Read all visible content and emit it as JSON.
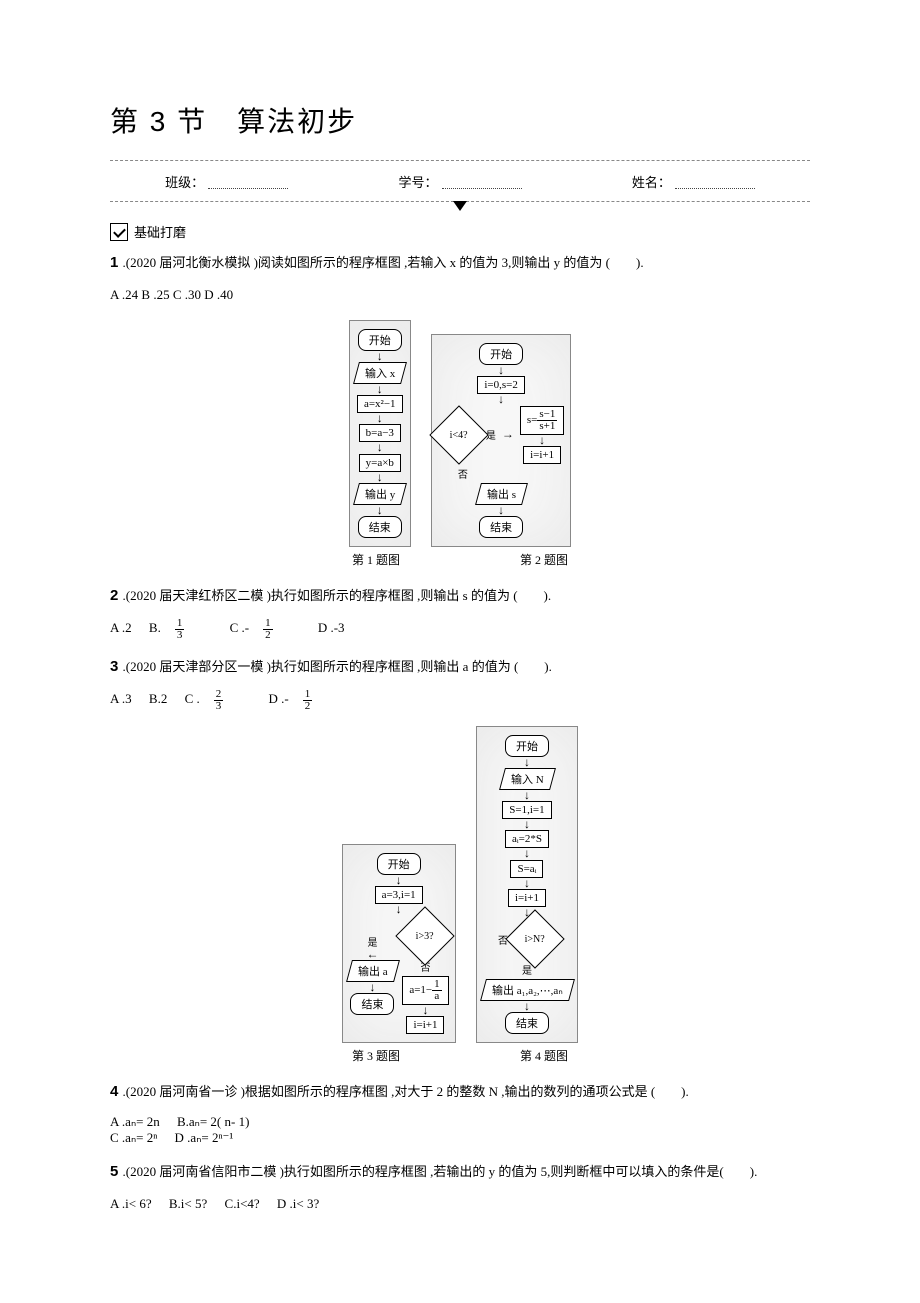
{
  "title": "第 3 节　算法初步",
  "header": {
    "class": "班级：",
    "id": "学号：",
    "name": "姓名："
  },
  "section1": "基础打磨",
  "q1": {
    "text": ".(2020 届河北衡水模拟 )阅读如图所示的程序框图 ,若输入 x 的值为 3,则输出 y 的值为 (　　).",
    "options": "A .24 B .25 C .30 D .40"
  },
  "caption12": {
    "c1": "第 1 题图",
    "c2": "第 2 题图"
  },
  "q2": {
    "text": ".(2020 届天津红桥区二模 )执行如图所示的程序框图 ,则输出 s 的值为 (　　).",
    "oA": "A .2",
    "oB_pre": "B.",
    "oB_n": "1",
    "oB_d": "3",
    "oC_pre": "C .-",
    "oC_n": "1",
    "oC_d": "2",
    "oD": "D .-3"
  },
  "q3": {
    "text": ".(2020 届天津部分区一模 )执行如图所示的程序框图 ,则输出 a 的值为 (　　).",
    "oA": "A .3",
    "oB": "B.2",
    "oC_pre": "C .",
    "oC_n": "2",
    "oC_d": "3",
    "oD_pre": "D .-",
    "oD_n": "1",
    "oD_d": "2"
  },
  "caption34": {
    "c3": "第 3 题图",
    "c4": "第 4 题图"
  },
  "q4": {
    "text": ".(2020 届河南省一诊 )根据如图所示的程序框图 ,对大于 2 的整数 N ,输出的数列的通项公式是 (　　).",
    "oA": "A .aₙ= 2n",
    "oB": "B.aₙ= 2( n- 1)",
    "oC": "C .aₙ= 2ⁿ",
    "oD": "D .aₙ= 2ⁿ⁻¹"
  },
  "q5": {
    "text": ".(2020 届河南省信阳市二模 )执行如图所示的程序框图 ,若输出的 y 的值为 5,则判断框中可以填入的条件是(　　).",
    "oA": "A .i< 6?",
    "oB": "B.i< 5?",
    "oC": "C.i<4?",
    "oD": "D .i< 3?"
  },
  "flow1": {
    "start": "开始",
    "in": "输入 x",
    "s1": "a=x²−1",
    "s2": "b=a−3",
    "s3": "y=a×b",
    "out": "输出 y",
    "end": "结束"
  },
  "flow2": {
    "start": "开始",
    "init": "i=0,s=2",
    "cond": "i<4?",
    "yes": "是",
    "no": "否",
    "upd_s": "s=",
    "upd_s_n": "s−1",
    "upd_s_d": "s+1",
    "upd_i": "i=i+1",
    "out": "输出 s",
    "end": "结束"
  },
  "flow3": {
    "start": "开始",
    "init": "a=3,i=1",
    "cond": "i>3?",
    "yes": "是",
    "no": "否",
    "out": "输出 a",
    "upd_a_pre": "a=1−",
    "upd_a_n": "1",
    "upd_a_d": "a",
    "upd_i": "i=i+1",
    "end": "结束"
  },
  "flow4": {
    "start": "开始",
    "in": "输入 N",
    "init": "S=1,i=1",
    "s1": "aᵢ=2*S",
    "s2": "S=aᵢ",
    "s3": "i=i+1",
    "cond": "i>N?",
    "yes": "是",
    "no": "否",
    "out": "输出 a₁,a₂,⋯,aₙ",
    "end": "结束"
  }
}
